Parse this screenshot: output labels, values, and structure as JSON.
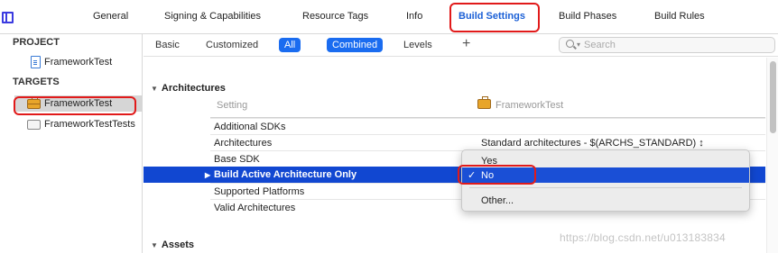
{
  "tabs": [
    "General",
    "Signing & Capabilities",
    "Resource Tags",
    "Info",
    "Build Settings",
    "Build Phases",
    "Build Rules"
  ],
  "navigator": {
    "project_header": "PROJECT",
    "project_item": "FrameworkTest",
    "targets_header": "TARGETS",
    "targets": [
      "FrameworkTest",
      "FrameworkTestTests"
    ]
  },
  "filter": {
    "basic": "Basic",
    "customized": "Customized",
    "all": "All",
    "combined": "Combined",
    "levels": "Levels",
    "add": "+",
    "search_placeholder": "Search"
  },
  "settings": {
    "architectures_title": "Architectures",
    "setting_col": "Setting",
    "target_col": "FrameworkTest",
    "rows": [
      {
        "name": "Additional SDKs",
        "value": ""
      },
      {
        "name": "Architectures",
        "value": "Standard architectures  -  $(ARCHS_STANDARD) ↕"
      },
      {
        "name": "Base SDK",
        "value": ""
      },
      {
        "name": "Build Active Architecture Only",
        "value": ""
      },
      {
        "name": "Supported Platforms",
        "value": ""
      },
      {
        "name": "Valid Architectures",
        "value": ""
      }
    ],
    "assets_title": "Assets"
  },
  "popup": {
    "options": [
      "Yes",
      "No",
      "Other..."
    ],
    "checkmark": "✓"
  },
  "watermark": "https://blog.csdn.net/u013183834",
  "colors": {
    "accent": "#1a6cf0",
    "selection": "#1147d1",
    "highlight": "#e11a1a"
  }
}
